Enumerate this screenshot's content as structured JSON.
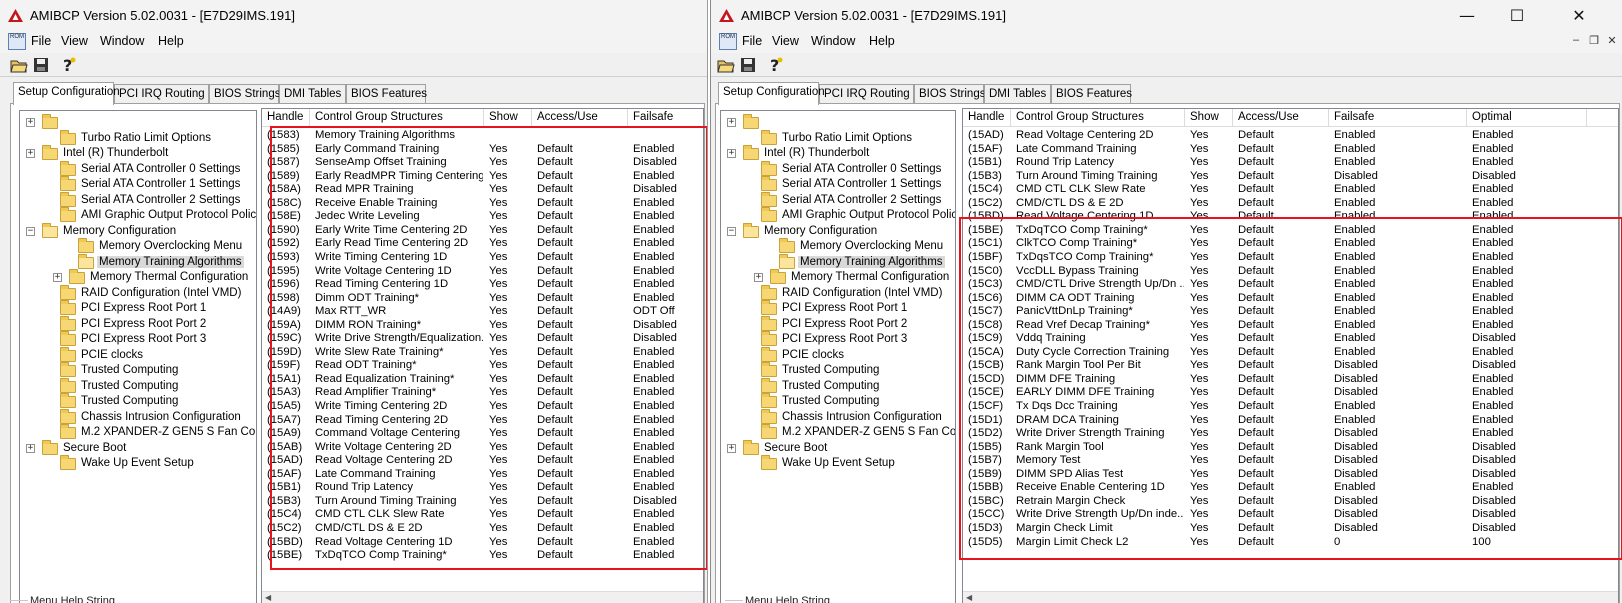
{
  "window_left": {
    "title": "AMIBCP Version 5.02.0031 - [E7D29IMS.191]",
    "menu": [
      "File",
      "View",
      "Window",
      "Help"
    ],
    "tabs": [
      "Setup Configuration",
      "PCI IRQ Routing",
      "BIOS Strings",
      "DMI Tables",
      "BIOS Features"
    ],
    "columns": [
      "Handle",
      "Control Group Structures",
      "Show",
      "Access/Use",
      "Failsafe"
    ],
    "rows": [
      [
        "(1583)",
        "Memory Training Algorithms",
        "",
        "",
        ""
      ],
      [
        "(1585)",
        "Early Command Training",
        "Yes",
        "Default",
        "Enabled"
      ],
      [
        "(1587)",
        "SenseAmp Offset Training",
        "Yes",
        "Default",
        "Disabled"
      ],
      [
        "(1589)",
        "Early ReadMPR Timing Centering...",
        "Yes",
        "Default",
        "Enabled"
      ],
      [
        "(158A)",
        "Read MPR Training",
        "Yes",
        "Default",
        "Disabled"
      ],
      [
        "(158C)",
        "Receive Enable Training",
        "Yes",
        "Default",
        "Enabled"
      ],
      [
        "(158E)",
        "Jedec Write Leveling",
        "Yes",
        "Default",
        "Enabled"
      ],
      [
        "(1590)",
        "Early Write Time Centering 2D",
        "Yes",
        "Default",
        "Enabled"
      ],
      [
        "(1592)",
        "Early Read Time Centering 2D",
        "Yes",
        "Default",
        "Enabled"
      ],
      [
        "(1593)",
        "Write Timing Centering 1D",
        "Yes",
        "Default",
        "Enabled"
      ],
      [
        "(1595)",
        "Write Voltage Centering 1D",
        "Yes",
        "Default",
        "Enabled"
      ],
      [
        "(1596)",
        "Read Timing Centering 1D",
        "Yes",
        "Default",
        "Enabled"
      ],
      [
        "(1598)",
        "Dimm ODT Training*",
        "Yes",
        "Default",
        "Enabled"
      ],
      [
        "(14A9)",
        "  Max RTT_WR",
        "Yes",
        "Default",
        "ODT Off"
      ],
      [
        "(159A)",
        "DIMM RON Training*",
        "Yes",
        "Default",
        "Disabled"
      ],
      [
        "(159C)",
        "Write Drive Strength/Equalization...",
        "Yes",
        "Default",
        "Disabled"
      ],
      [
        "(159D)",
        "Write Slew Rate Training*",
        "Yes",
        "Default",
        "Enabled"
      ],
      [
        "(159F)",
        "Read ODT Training*",
        "Yes",
        "Default",
        "Enabled"
      ],
      [
        "(15A1)",
        "Read Equalization Training*",
        "Yes",
        "Default",
        "Enabled"
      ],
      [
        "(15A3)",
        "Read Amplifier Training*",
        "Yes",
        "Default",
        "Enabled"
      ],
      [
        "(15A5)",
        "Write Timing Centering 2D",
        "Yes",
        "Default",
        "Enabled"
      ],
      [
        "(15A7)",
        "Read Timing Centering 2D",
        "Yes",
        "Default",
        "Enabled"
      ],
      [
        "(15A9)",
        "Command Voltage Centering",
        "Yes",
        "Default",
        "Enabled"
      ],
      [
        "(15AB)",
        "Write Voltage Centering 2D",
        "Yes",
        "Default",
        "Enabled"
      ],
      [
        "(15AD)",
        "Read Voltage Centering 2D",
        "Yes",
        "Default",
        "Enabled"
      ],
      [
        "(15AF)",
        "Late Command Training",
        "Yes",
        "Default",
        "Enabled"
      ],
      [
        "(15B1)",
        "Round Trip Latency",
        "Yes",
        "Default",
        "Enabled"
      ],
      [
        "(15B3)",
        "Turn Around Timing Training",
        "Yes",
        "Default",
        "Disabled"
      ],
      [
        "(15C4)",
        "CMD CTL CLK Slew Rate",
        "Yes",
        "Default",
        "Enabled"
      ],
      [
        "(15C2)",
        "CMD/CTL DS & E 2D",
        "Yes",
        "Default",
        "Enabled"
      ],
      [
        "(15BD)",
        "Read Voltage Centering 1D",
        "Yes",
        "Default",
        "Enabled"
      ],
      [
        "(15BE)",
        "TxDqTCO Comp Training*",
        "Yes",
        "Default",
        "Enabled"
      ]
    ],
    "help_label": "Menu Help String"
  },
  "window_right": {
    "title": "AMIBCP Version 5.02.0031 - [E7D29IMS.191]",
    "menu": [
      "File",
      "View",
      "Window",
      "Help"
    ],
    "tabs": [
      "Setup Configuration",
      "PCI IRQ Routing",
      "BIOS Strings",
      "DMI Tables",
      "BIOS Features"
    ],
    "columns": [
      "Handle",
      "Control Group Structures",
      "Show",
      "Access/Use",
      "Failsafe",
      "Optimal"
    ],
    "rows": [
      [
        "(15AD)",
        "Read Voltage Centering 2D",
        "Yes",
        "Default",
        "Enabled",
        "Enabled"
      ],
      [
        "(15AF)",
        "Late Command Training",
        "Yes",
        "Default",
        "Enabled",
        "Enabled"
      ],
      [
        "(15B1)",
        "Round Trip Latency",
        "Yes",
        "Default",
        "Enabled",
        "Enabled"
      ],
      [
        "(15B3)",
        "Turn Around Timing Training",
        "Yes",
        "Default",
        "Disabled",
        "Disabled"
      ],
      [
        "(15C4)",
        "CMD CTL CLK Slew Rate",
        "Yes",
        "Default",
        "Enabled",
        "Enabled"
      ],
      [
        "(15C2)",
        "CMD/CTL DS & E 2D",
        "Yes",
        "Default",
        "Enabled",
        "Enabled"
      ],
      [
        "(15BD)",
        "Read Voltage Centering 1D",
        "Yes",
        "Default",
        "Enabled",
        "Enabled"
      ],
      [
        "(15BE)",
        "TxDqTCO Comp Training*",
        "Yes",
        "Default",
        "Enabled",
        "Enabled"
      ],
      [
        "(15C1)",
        "ClkTCO Comp Training*",
        "Yes",
        "Default",
        "Enabled",
        "Enabled"
      ],
      [
        "(15BF)",
        "TxDqsTCO Comp Training*",
        "Yes",
        "Default",
        "Enabled",
        "Enabled"
      ],
      [
        "(15C0)",
        "VccDLL Bypass Training",
        "Yes",
        "Default",
        "Enabled",
        "Enabled"
      ],
      [
        "(15C3)",
        "CMD/CTL Drive Strength Up/Dn ...",
        "Yes",
        "Default",
        "Enabled",
        "Enabled"
      ],
      [
        "(15C6)",
        "DIMM CA ODT Training",
        "Yes",
        "Default",
        "Enabled",
        "Enabled"
      ],
      [
        "(15C7)",
        "PanicVttDnLp Training*",
        "Yes",
        "Default",
        "Enabled",
        "Enabled"
      ],
      [
        "(15C8)",
        "Read Vref Decap Training*",
        "Yes",
        "Default",
        "Enabled",
        "Enabled"
      ],
      [
        "(15C9)",
        "Vddq Training",
        "Yes",
        "Default",
        "Enabled",
        "Disabled"
      ],
      [
        "(15CA)",
        "Duty Cycle Correction Training",
        "Yes",
        "Default",
        "Enabled",
        "Enabled"
      ],
      [
        "(15CB)",
        "Rank Margin Tool Per Bit",
        "Yes",
        "Default",
        "Disabled",
        "Disabled"
      ],
      [
        "(15CD)",
        "DIMM DFE Training",
        "Yes",
        "Default",
        "Disabled",
        "Enabled"
      ],
      [
        "(15CE)",
        "EARLY DIMM DFE Training",
        "Yes",
        "Default",
        "Disabled",
        "Enabled"
      ],
      [
        "(15CF)",
        "Tx Dqs Dcc Training",
        "Yes",
        "Default",
        "Enabled",
        "Enabled"
      ],
      [
        "(15D1)",
        "DRAM DCA Training",
        "Yes",
        "Default",
        "Enabled",
        "Enabled"
      ],
      [
        "(15D2)",
        "Write Driver Strength Training",
        "Yes",
        "Default",
        "Disabled",
        "Enabled"
      ],
      [
        "(15B5)",
        "Rank Margin Tool",
        "Yes",
        "Default",
        "Disabled",
        "Disabled"
      ],
      [
        "(15B7)",
        "Memory Test",
        "Yes",
        "Default",
        "Disabled",
        "Disabled"
      ],
      [
        "(15B9)",
        "DIMM SPD Alias Test",
        "Yes",
        "Default",
        "Disabled",
        "Disabled"
      ],
      [
        "(15BB)",
        "Receive Enable Centering 1D",
        "Yes",
        "Default",
        "Enabled",
        "Enabled"
      ],
      [
        "(15BC)",
        "Retrain Margin Check",
        "Yes",
        "Default",
        "Disabled",
        "Disabled"
      ],
      [
        "(15CC)",
        "Write Drive Strength Up/Dn inde...",
        "Yes",
        "Default",
        "Disabled",
        "Disabled"
      ],
      [
        "(15D3)",
        "Margin Check Limit",
        "Yes",
        "Default",
        "Disabled",
        "Disabled"
      ],
      [
        "(15D5)",
        "Margin Limit Check L2",
        "Yes",
        "Default",
        "0",
        "100"
      ]
    ],
    "help_label": "Menu Help String"
  },
  "tree": [
    {
      "label": "",
      "indent": 0,
      "box": "+",
      "open": false
    },
    {
      "label": "Turbo Ratio Limit Options",
      "indent": 1,
      "box": "",
      "open": false
    },
    {
      "label": "Intel (R) Thunderbolt",
      "indent": 0,
      "box": "+",
      "open": false
    },
    {
      "label": "Serial ATA Controller 0 Settings",
      "indent": 1,
      "box": "",
      "open": false
    },
    {
      "label": "Serial ATA Controller 1 Settings",
      "indent": 1,
      "box": "",
      "open": false
    },
    {
      "label": "Serial ATA Controller 2 Settings",
      "indent": 1,
      "box": "",
      "open": false
    },
    {
      "label": "AMI Graphic Output Protocol Policy",
      "indent": 1,
      "box": "",
      "open": false
    },
    {
      "label": "Memory Configuration",
      "indent": 0,
      "box": "-",
      "open": true
    },
    {
      "label": "Memory Overclocking Menu",
      "indent": 2,
      "box": "",
      "open": false
    },
    {
      "label": "Memory Training Algorithms",
      "indent": 2,
      "box": "",
      "open": true,
      "selected": true
    },
    {
      "label": "Memory Thermal Configuration",
      "indent": 1.5,
      "box": "+",
      "open": false
    },
    {
      "label": "RAID Configuration (Intel VMD)",
      "indent": 1,
      "box": "",
      "open": false
    },
    {
      "label": "PCI Express Root Port 1",
      "indent": 1,
      "box": "",
      "open": false
    },
    {
      "label": "PCI Express Root Port 2",
      "indent": 1,
      "box": "",
      "open": false
    },
    {
      "label": "PCI Express Root Port 3",
      "indent": 1,
      "box": "",
      "open": false
    },
    {
      "label": "PCIE clocks",
      "indent": 1,
      "box": "",
      "open": false
    },
    {
      "label": "Trusted Computing",
      "indent": 1,
      "box": "",
      "open": false
    },
    {
      "label": "Trusted Computing",
      "indent": 1,
      "box": "",
      "open": false
    },
    {
      "label": "Trusted Computing",
      "indent": 1,
      "box": "",
      "open": false
    },
    {
      "label": "Chassis Intrusion Configuration",
      "indent": 1,
      "box": "",
      "open": false
    },
    {
      "label": "M.2 XPANDER-Z GEN5 S Fan Control",
      "indent": 1,
      "box": "",
      "open": false
    },
    {
      "label": "Secure Boot",
      "indent": 0,
      "box": "+",
      "open": false
    },
    {
      "label": "Wake Up Event Setup",
      "indent": 1,
      "box": "",
      "open": false
    }
  ],
  "colors": {
    "highlight_border": "#e8141c",
    "selection": "#d9d9d9",
    "folder": "#f7d774"
  },
  "icons": [
    "app-logo-icon",
    "document-icon",
    "open-folder-icon",
    "save-disk-icon",
    "help-icon",
    "minimize-icon",
    "maximize-icon",
    "close-icon"
  ]
}
